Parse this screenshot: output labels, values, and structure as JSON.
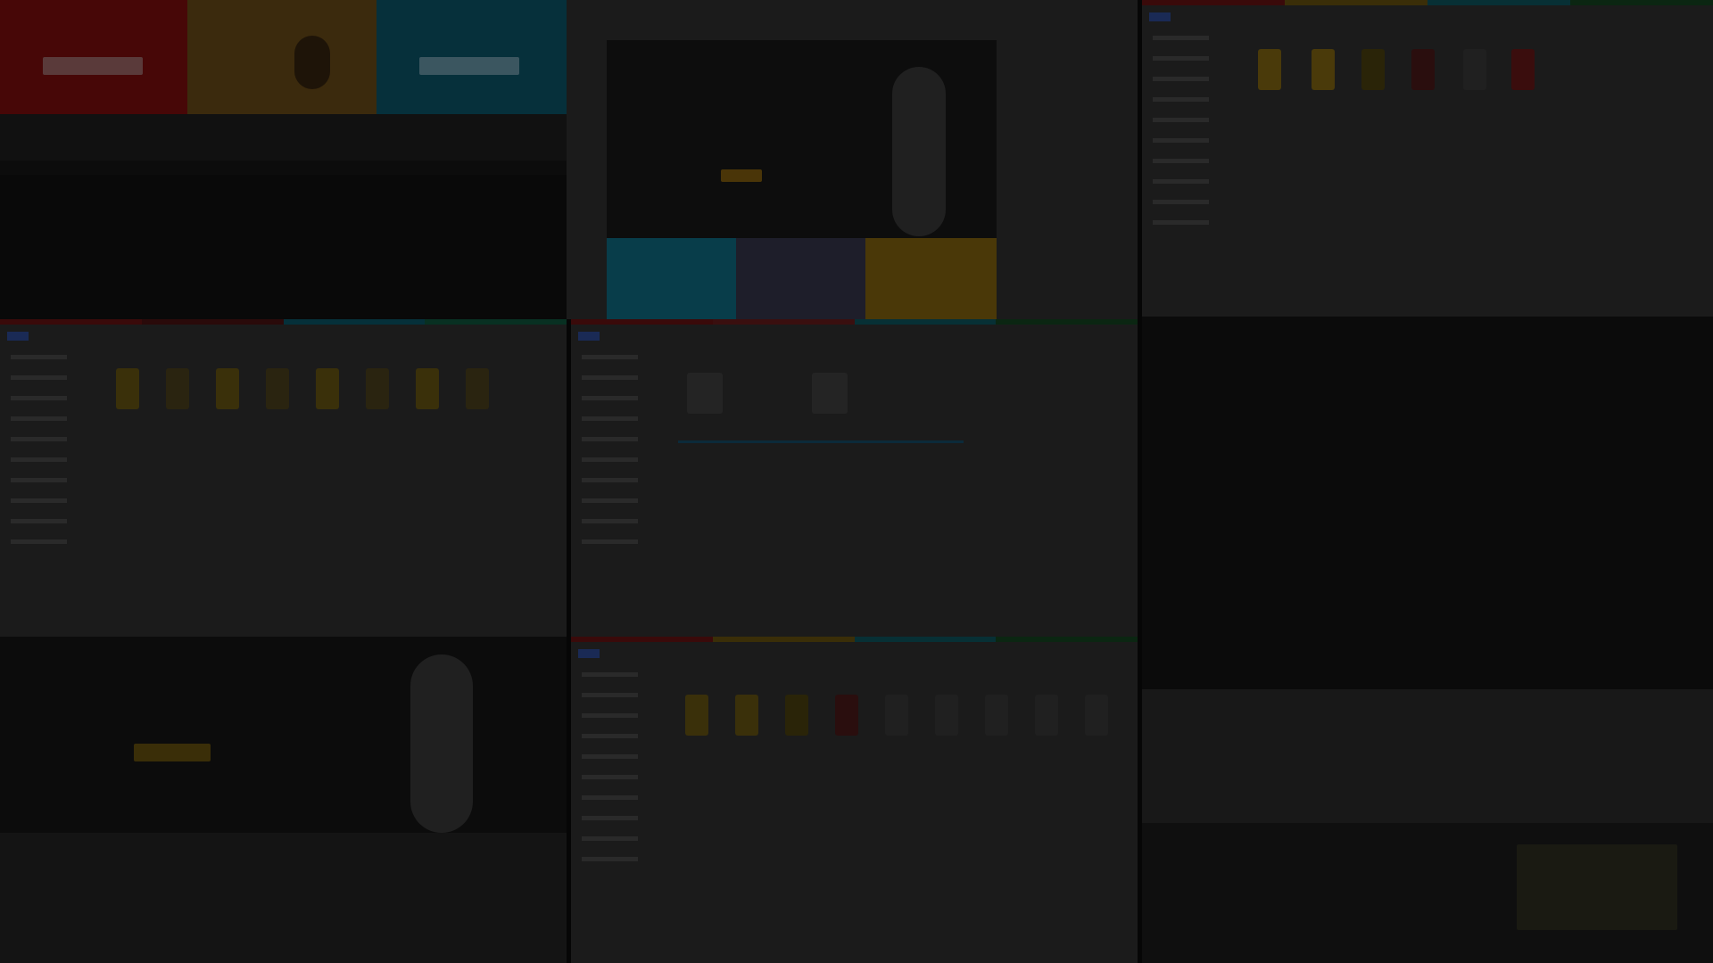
{
  "colors": {
    "red": "#4a0808",
    "gold": "#3f2c0c",
    "teal": "#06323d",
    "yellow": "#5a4808",
    "blue": "#182a6a"
  },
  "icons": {
    "product": "product-thumbnail-icon",
    "logo": "site-logo-icon"
  }
}
